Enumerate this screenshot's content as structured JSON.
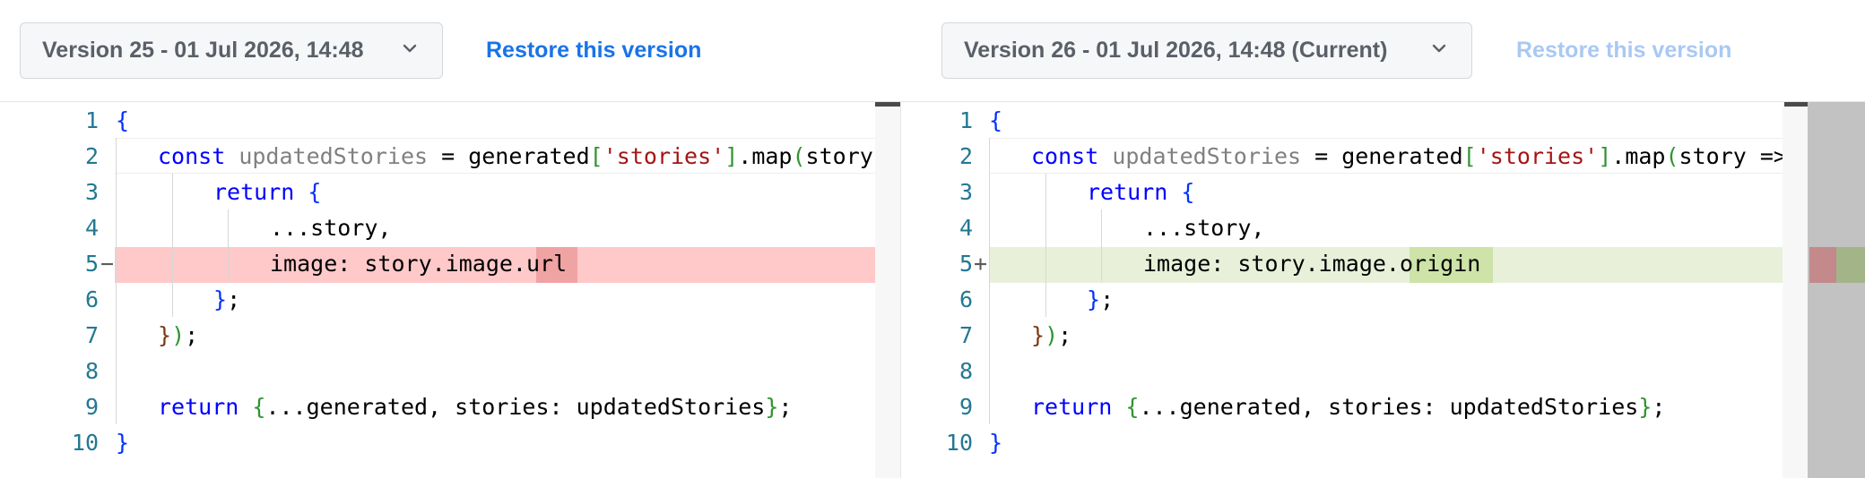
{
  "left": {
    "version_label": "Version 25 - 01 Jul 2026, 14:48",
    "restore_label": "Restore this version",
    "lines": [
      "1",
      "2",
      "3",
      "4",
      "5",
      "6",
      "7",
      "8",
      "9",
      "10"
    ],
    "line5_marker": "−",
    "code": {
      "l1": "{",
      "l2_const": "const",
      "l2_var": "updatedStories",
      "l2_mid": " = generated",
      "l2_open": "[",
      "l2_str": "'stories'",
      "l2_close": "]",
      "l2_map": ".map",
      "l2_paren": "(",
      "l2_tail": "story",
      "l3_return": "return",
      "l3_brace": "{",
      "l4": "...story,",
      "l5_pre": "image: story.image.",
      "l5_word": "url",
      "l6_brace": "}",
      "l6_semi": ";",
      "l7_brace": "}",
      "l7_paren": ")",
      "l7_semi": ";",
      "l9_return": "return",
      "l9_open": "{",
      "l9_mid": "...generated, stories: updatedStories",
      "l9_close": "}",
      "l9_semi": ";",
      "l10": "}"
    }
  },
  "right": {
    "version_label": "Version 26 - 01 Jul 2026, 14:48 (Current)",
    "restore_label": "Restore this version",
    "lines": [
      "1",
      "2",
      "3",
      "4",
      "5",
      "6",
      "7",
      "8",
      "9",
      "10"
    ],
    "line5_marker": "+",
    "code": {
      "l1": "{",
      "l2_const": "const",
      "l2_var": "updatedStories",
      "l2_mid": " = generated",
      "l2_open": "[",
      "l2_str": "'stories'",
      "l2_close": "]",
      "l2_map": ".map",
      "l2_paren": "(",
      "l2_tail": "story =>",
      "l3_return": "return",
      "l3_brace": "{",
      "l4": "...story,",
      "l5_pre": "image: story.image.",
      "l5_word": "origin",
      "l6_brace": "}",
      "l6_semi": ";",
      "l7_brace": "}",
      "l7_paren": ")",
      "l7_semi": ";",
      "l9_return": "return",
      "l9_open": "{",
      "l9_mid": "...generated, stories: updatedStories",
      "l9_close": "}",
      "l9_semi": ";",
      "l10": "}"
    }
  },
  "colors": {
    "link": "#1a73e8",
    "link_disabled": "#a9c9f2",
    "deleted_line": "#ffc9c9",
    "deleted_word": "#f0a3a3",
    "added_line": "#e8f0d9",
    "added_word": "#cde3a8"
  }
}
